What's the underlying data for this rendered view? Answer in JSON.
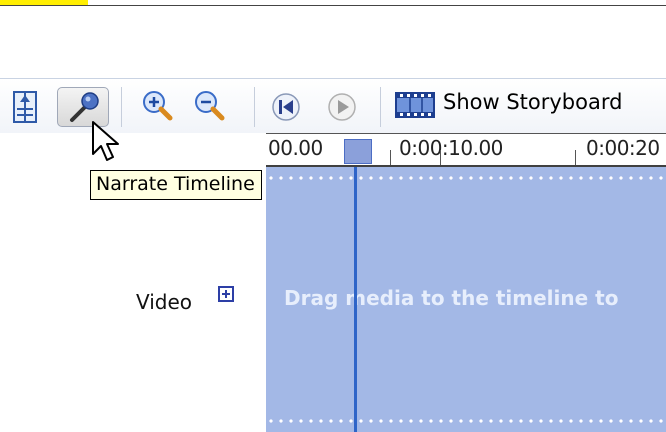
{
  "toolbar": {
    "buttons": [
      {
        "name": "set-audio-levels",
        "icon": "audio-levels-icon"
      },
      {
        "name": "narrate-timeline",
        "icon": "microphone-icon",
        "pressed": true
      },
      {
        "name": "zoom-in",
        "icon": "zoom-in-icon"
      },
      {
        "name": "zoom-out",
        "icon": "zoom-out-icon"
      },
      {
        "name": "rewind",
        "icon": "rewind-icon"
      },
      {
        "name": "play",
        "icon": "play-icon"
      }
    ],
    "show_storyboard_label": "Show Storyboard"
  },
  "tooltip": {
    "text": "Narrate Timeline"
  },
  "timeline": {
    "ruler_labels": [
      "00.00",
      "0:00:10.00",
      "0:00:20"
    ],
    "video_track": {
      "label": "Video",
      "drop_hint": "Drag media to the timeline to"
    }
  },
  "colors": {
    "track_fill": "#a3b8e6",
    "playhead": "#2e64c8",
    "tooltip_bg": "#ffffe1",
    "highlight": "#ffee00"
  }
}
